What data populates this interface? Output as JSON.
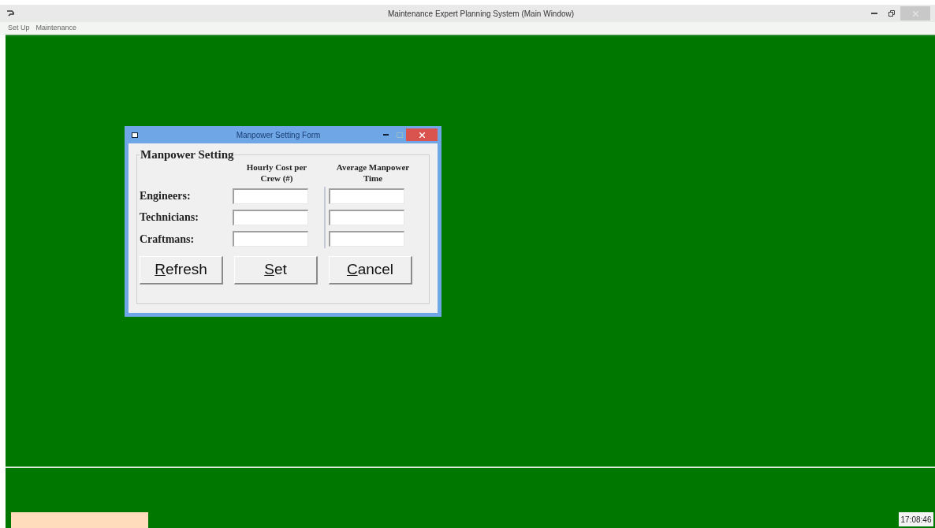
{
  "window": {
    "title": "Maintenance Expert Planning System (Main Window)"
  },
  "menu": [
    {
      "label": "Set Up"
    },
    {
      "label": "Maintenance"
    }
  ],
  "dialog": {
    "title": "Manpower Setting Form",
    "group_title": "Manpower Setting",
    "columns": [
      "Hourly Cost per Crew (#)",
      "Average Manpower Time"
    ],
    "rows": [
      {
        "label": "Engineers:"
      },
      {
        "label": "Technicians:"
      },
      {
        "label": "Craftmans:"
      }
    ],
    "buttons": [
      {
        "mnemonic": "R",
        "rest": "efresh"
      },
      {
        "mnemonic": "S",
        "rest": "et"
      },
      {
        "mnemonic": "C",
        "rest": "ancel"
      }
    ]
  },
  "status_bar": {
    "time": "17:08:46"
  }
}
